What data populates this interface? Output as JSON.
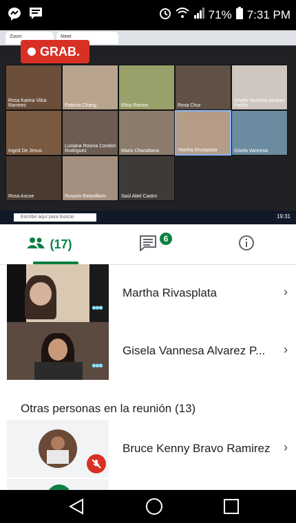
{
  "status": {
    "battery": "71%",
    "time": "7:31 PM"
  },
  "meeting": {
    "rec_label": "GRAB.",
    "tile_names": [
      "Rosa Karina Vilca Ramirez",
      "Patricia Chang",
      "Elisa Ramos",
      "Rosa Chur",
      "Gisela Vannesa Alvarez Patiño",
      "Ingrid De Jesus",
      "Luciana Rosina Condori Rodriguez",
      "Mario Chacaltana",
      "Martha Rivasplata",
      "Gisela Vannesa",
      "Rosa Ascue",
      "Rosario Batavillarin",
      "Saúl Abel Castro"
    ],
    "search_placeholder": "Escribe aquí para buscar",
    "clock": "19:31"
  },
  "panel": {
    "people_count": "(17)",
    "chat_badge": "6",
    "participants_top": [
      "Martha Rivasplata",
      "Gisela Vannesa Alvarez P..."
    ],
    "section_title": "Otras personas en la reunión (13)",
    "participants_other": [
      "Bruce Kenny Bravo Ramirez"
    ]
  },
  "colors": {
    "accent": "#0b8043",
    "rec": "#d93025",
    "mic_off": "#d93025"
  }
}
